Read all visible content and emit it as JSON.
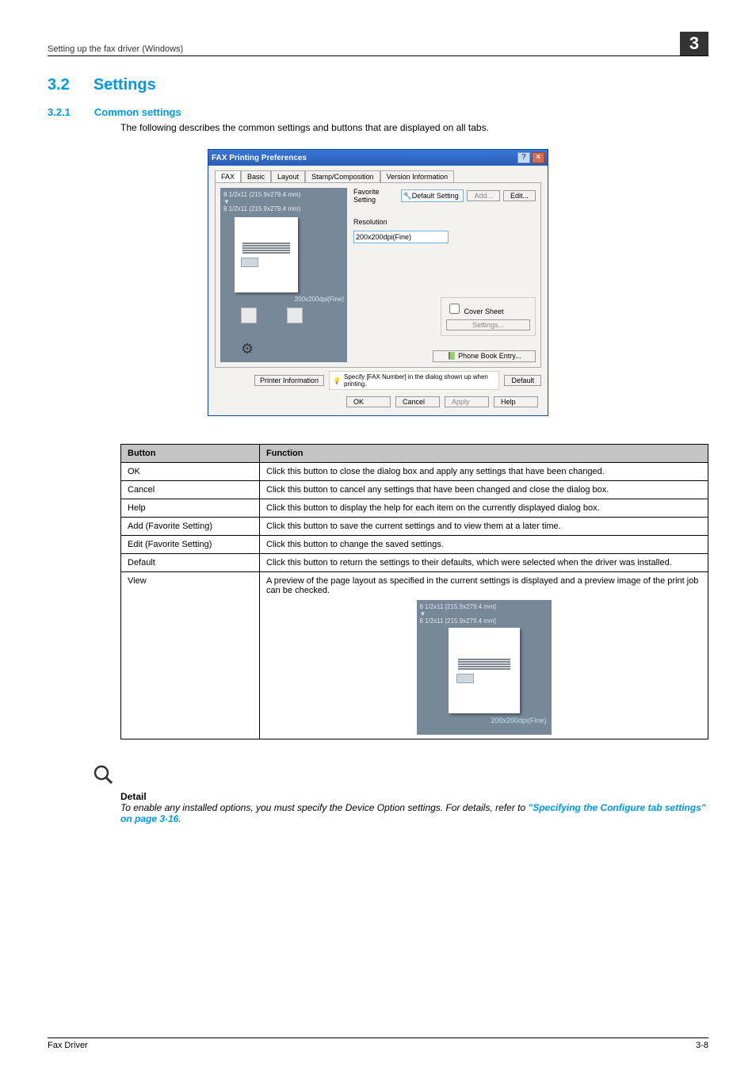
{
  "header": {
    "running_head": "Setting up the fax driver (Windows)",
    "chapter_num": "3"
  },
  "h2": {
    "num": "3.2",
    "title": "Settings"
  },
  "h3": {
    "num": "3.2.1",
    "title": "Common settings"
  },
  "intro": "The following describes the common settings and buttons that are displayed on all tabs.",
  "dialog": {
    "title": "FAX Printing Preferences",
    "tabs": [
      "FAX",
      "Basic",
      "Layout",
      "Stamp/Composition",
      "Version Information"
    ],
    "preview": {
      "size1": "8 1/2x11 (215.9x279.4 mm)",
      "size2": "8 1/2x11 (215.9x279.4 mm)",
      "res": "200x200dpi(Fine)"
    },
    "favorite_label": "Favorite Setting",
    "favorite_value": "Default Setting",
    "add_btn": "Add...",
    "edit_btn": "Edit...",
    "resolution_label": "Resolution",
    "resolution_value": "200x200dpi(Fine)",
    "cover_checkbox": "Cover Sheet",
    "cover_settings_btn": "Settings...",
    "phonebook_btn": "Phone Book Entry...",
    "printer_info_btn": "Printer Information",
    "hint": "Specify [FAX Number] in the dialog shown up when printing.",
    "default_btn": "Default",
    "footer": {
      "ok": "OK",
      "cancel": "Cancel",
      "apply": "Apply",
      "help": "Help"
    }
  },
  "table": {
    "col1": "Button",
    "col2": "Function",
    "rows": [
      {
        "b": "OK",
        "f": "Click this button to close the dialog box and apply any settings that have been changed."
      },
      {
        "b": "Cancel",
        "f": "Click this button to cancel any settings that have been changed and close the dialog box."
      },
      {
        "b": "Help",
        "f": "Click this button to display the help for each item on the currently displayed dialog box."
      },
      {
        "b": "Add (Favorite Setting)",
        "f": "Click this button to save the current settings and to view them at a later time."
      },
      {
        "b": "Edit (Favorite Setting)",
        "f": "Click this button to change the saved settings."
      },
      {
        "b": "Default",
        "f": "Click this button to return the settings to their defaults, which were selected when the driver was installed."
      },
      {
        "b": "View",
        "f": "A preview of the page layout as specified in the current settings is displayed and a preview image of the print job can be checked."
      }
    ],
    "view_preview": {
      "size1": "8 1/2x11 [215.9x279.4 mm]",
      "size2": "8 1/2x11 [215.9x279.4 mm]",
      "res": "200x200dpi(Fine)"
    }
  },
  "detail": {
    "label": "Detail",
    "text1": "To enable any installed options, you must specify the Device Option settings. For details, refer to ",
    "link": "\"Specifying the Configure tab settings\" on page 3-16",
    "text2": "."
  },
  "footer": {
    "left": "Fax Driver",
    "right": "3-8"
  }
}
